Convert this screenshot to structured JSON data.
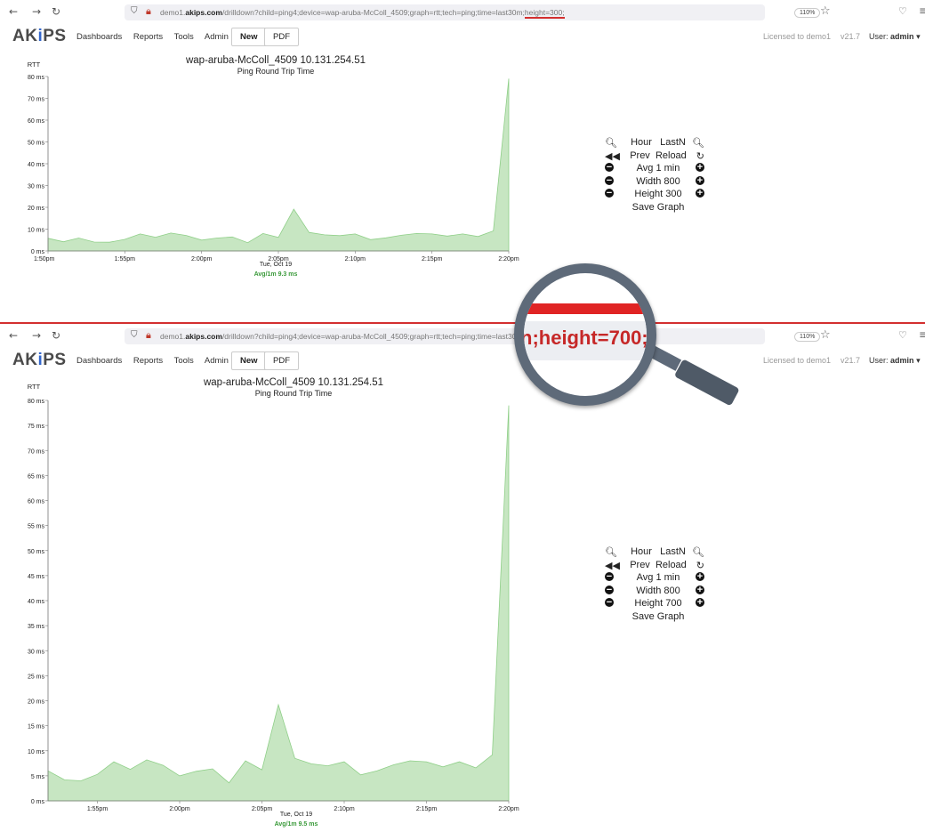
{
  "browser": {
    "back_icon": "←",
    "forward_icon": "→",
    "reload_icon": "↻",
    "url_prefix": "demo1.",
    "url_domain": "akips.com",
    "url_path": "/drilldown?child=ping4;device=wap-aruba-McColl_4509;graph=rtt;tech=ping;time=last30m;",
    "url_path_bottom": "/drilldown?child=ping4;device=wap-aruba-McColl_4509;graph=rtt;tech=ping;time=last30",
    "url_highlight": "height=300;",
    "zoom": "110%"
  },
  "header": {
    "logo_a": "AK",
    "logo_i": "i",
    "logo_b": "PS",
    "menu": [
      "Dashboards",
      "Reports",
      "Tools",
      "Admin"
    ],
    "new_label": "New",
    "pdf_label": "PDF",
    "license": "Licensed to demo1",
    "version": "v21.7",
    "user_label": "User:",
    "user_name": "admin",
    "user_caret": "▾"
  },
  "graph_top": {
    "title": "wap-aruba-McColl_4509  10.131.254.51",
    "subtitle": "Ping Round Trip Time",
    "ylabel": "RTT",
    "date": "Tue, Oct 19",
    "avg": "Avg/1m 9.3 ms"
  },
  "graph_bottom": {
    "title": "wap-aruba-McColl_4509  10.131.254.51",
    "subtitle": "Ping Round Trip Time",
    "ylabel": "RTT",
    "date": "Tue, Oct 19",
    "avg": "Avg/1m 9.5 ms"
  },
  "controls_top": {
    "hour": "Hour",
    "lastn": "LastN",
    "prev": "Prev",
    "reload": "Reload",
    "avg": "Avg 1 min",
    "width": "Width 800",
    "height": "Height 300",
    "save": "Save Graph"
  },
  "controls_bottom": {
    "hour": "Hour",
    "lastn": "LastN",
    "prev": "Prev",
    "reload": "Reload",
    "avg": "Avg 1 min",
    "width": "Width 800",
    "height": "Height 700",
    "save": "Save Graph"
  },
  "magnifier": {
    "text": "n;height=700;"
  },
  "colors": {
    "area_fill": "#c7e6c2",
    "area_stroke": "#8fcf88",
    "avg_text": "#3a9a3a",
    "accent_red": "#d32f2f"
  },
  "chart_data": [
    {
      "type": "area",
      "title": "wap-aruba-McColl_4509  10.131.254.51",
      "subtitle": "Ping Round Trip Time",
      "ylabel": "RTT",
      "xlabel": "Tue, Oct 19",
      "ylim": [
        0,
        80
      ],
      "yticks": [
        "0 ms",
        "10 ms",
        "20 ms",
        "30 ms",
        "40 ms",
        "50 ms",
        "60 ms",
        "70 ms",
        "80 ms"
      ],
      "xticks": [
        "1:50pm",
        "1:55pm",
        "2:00pm",
        "2:05pm",
        "2:10pm",
        "2:15pm",
        "2:20pm"
      ],
      "x_minutes": [
        0,
        5,
        10,
        15,
        20,
        25,
        30
      ],
      "series": [
        {
          "values": [
            5.8,
            4.2,
            5.9,
            4.1,
            4.0,
            5.3,
            7.8,
            6.3,
            8.2,
            7.1,
            5.0,
            5.9,
            6.4,
            3.8,
            8.0,
            6.2,
            19.2,
            8.5,
            7.4,
            7.0,
            7.8,
            5.2,
            6.0,
            7.2,
            8.0,
            7.8,
            6.8,
            7.8,
            6.6,
            9.2,
            79.0
          ]
        }
      ]
    },
    {
      "type": "area",
      "title": "wap-aruba-McColl_4509  10.131.254.51",
      "subtitle": "Ping Round Trip Time",
      "ylabel": "RTT",
      "xlabel": "Tue, Oct 19",
      "ylim": [
        0,
        80
      ],
      "yticks": [
        "0 ms",
        "5 ms",
        "10 ms",
        "15 ms",
        "20 ms",
        "25 ms",
        "30 ms",
        "35 ms",
        "40 ms",
        "45 ms",
        "50 ms",
        "55 ms",
        "60 ms",
        "65 ms",
        "70 ms",
        "75 ms",
        "80 ms"
      ],
      "xticks": [
        "1:55pm",
        "2:00pm",
        "2:05pm",
        "2:10pm",
        "2:15pm",
        "2:20pm"
      ],
      "x_minutes": [
        5,
        10,
        15,
        20,
        25,
        30
      ],
      "series": [
        {
          "values": [
            6.0,
            4.2,
            4.0,
            5.3,
            7.8,
            6.3,
            8.2,
            7.1,
            5.0,
            5.9,
            6.4,
            3.6,
            8.0,
            6.2,
            19.2,
            8.5,
            7.4,
            7.0,
            7.8,
            5.2,
            6.0,
            7.2,
            8.0,
            7.8,
            6.8,
            7.8,
            6.6,
            9.2,
            79.0
          ]
        }
      ]
    }
  ]
}
